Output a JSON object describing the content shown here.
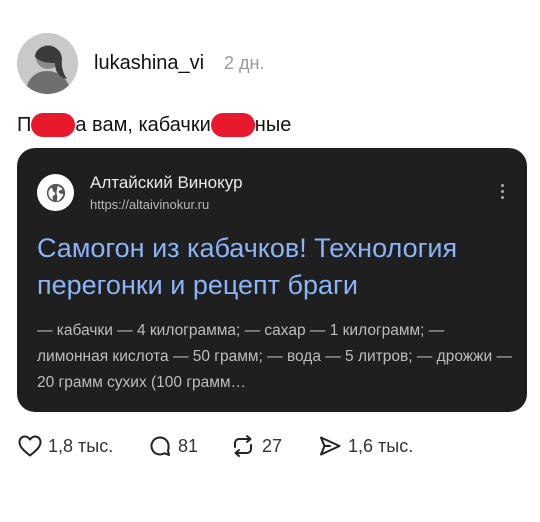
{
  "post": {
    "username": "lukashina_vi",
    "timestamp": "2 дн.",
    "text_part1": "П",
    "text_part2": "а вам, кабачки",
    "text_part3": "ные"
  },
  "link_card": {
    "site_name": "Алтайский Винокур",
    "site_url": "https://altaivinokur.ru",
    "title": "Самогон из кабачков! Технология перегонки и рецепт браги",
    "snippet": "— кабачки — 4 килограмма; — сахар — 1 килограмм; — лимонная кислота — 50 грамм; — вода — 5 литров; — дрожжи — 20 грамм сухих (100 грамм…"
  },
  "actions": {
    "likes": "1,8 тыс.",
    "replies": "81",
    "reposts": "27",
    "shares": "1,6 тыс."
  },
  "colors": {
    "redaction": "#e8192c",
    "card_bg": "#1f1f1f",
    "link_title": "#8ab4f8"
  },
  "icons": {
    "avatar": "avatar",
    "site": "globe-icon",
    "menu": "more-vertical-icon",
    "like": "heart-icon",
    "reply": "comment-icon",
    "repost": "repost-icon",
    "share": "send-icon"
  }
}
